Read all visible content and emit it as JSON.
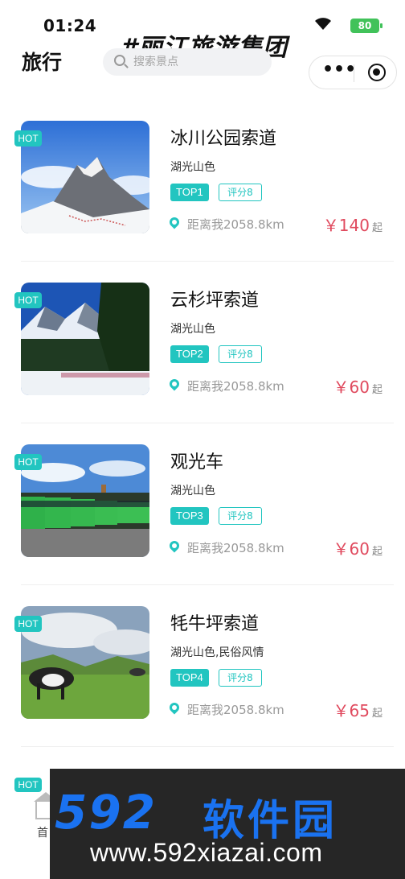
{
  "status_bar": {
    "time": "01:24",
    "battery": "80"
  },
  "watermark_top": "#丽江旅游集团",
  "header": {
    "title": "旅行",
    "search_placeholder": "搜索景点"
  },
  "items": [
    {
      "hot": "HOT",
      "title": "冰川公园索道",
      "tags": "湖光山色",
      "rank": "TOP1",
      "score": "评分8",
      "distance": "距离我2058.8km",
      "price": "￥140",
      "price_suffix": "起",
      "scene": "glacier"
    },
    {
      "hot": "HOT",
      "title": "云杉坪索道",
      "tags": "湖光山色",
      "rank": "TOP2",
      "score": "评分8",
      "distance": "距离我2058.8km",
      "price": "￥60",
      "price_suffix": "起",
      "scene": "spruce"
    },
    {
      "hot": "HOT",
      "title": "观光车",
      "tags": "湖光山色",
      "rank": "TOP3",
      "score": "评分8",
      "distance": "距离我2058.8km",
      "price": "￥60",
      "price_suffix": "起",
      "scene": "buses"
    },
    {
      "hot": "HOT",
      "title": "牦牛坪索道",
      "tags": "湖光山色,民俗风情",
      "rank": "TOP4",
      "score": "评分8",
      "distance": "距离我2058.8km",
      "price": "￥65",
      "price_suffix": "起",
      "scene": "yak"
    }
  ],
  "partial_item": {
    "hot": "HOT"
  },
  "tabbar": {
    "home_label": "首"
  },
  "banner": {
    "logo_digits": "592",
    "logo_text": "软件园",
    "url": "www.592xiazai.com"
  },
  "colors": {
    "accent": "#22c5c0",
    "price": "#e04a5e",
    "banner_blue": "#1a72f0"
  }
}
